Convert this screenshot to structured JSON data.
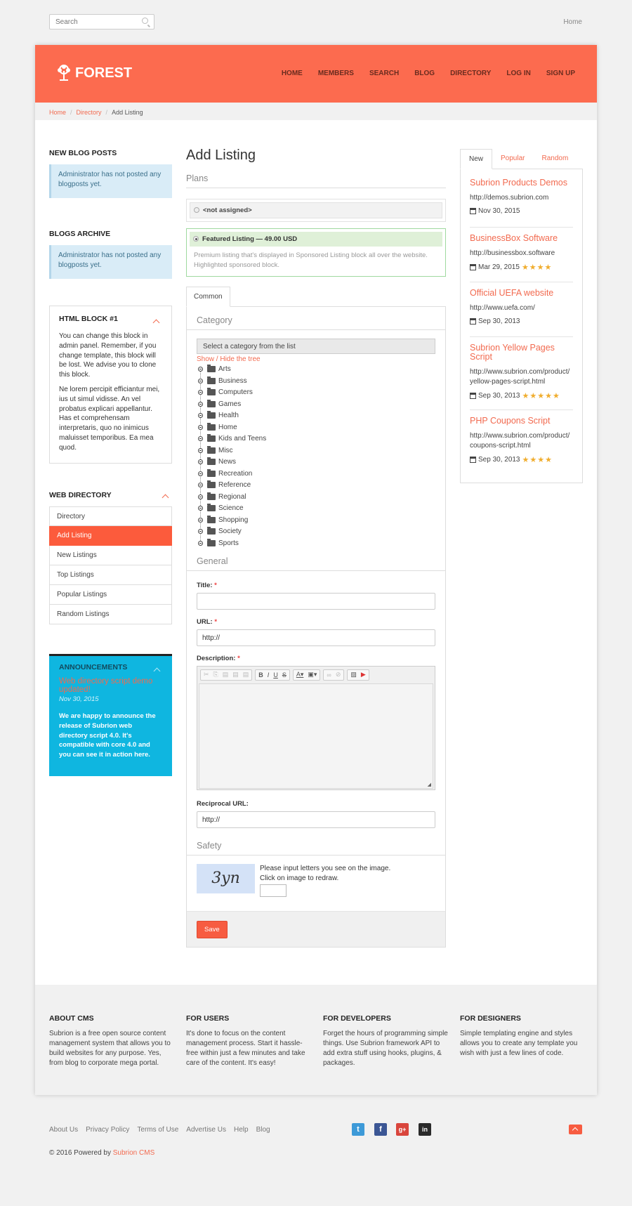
{
  "topbar": {
    "search_placeholder": "Search",
    "home_link": "Home"
  },
  "header": {
    "logo": "FOREST",
    "nav": [
      "HOME",
      "MEMBERS",
      "SEARCH",
      "BLOG",
      "DIRECTORY",
      "LOG IN",
      "SIGN UP"
    ]
  },
  "breadcrumb": {
    "home": "Home",
    "directory": "Directory",
    "current": "Add Listing"
  },
  "left": {
    "blog_posts": {
      "title": "NEW BLOG POSTS",
      "text": "Administrator has not posted any blogposts yet."
    },
    "blogs_archive": {
      "title": "BLOGS ARCHIVE",
      "text": "Administrator has not posted any blogposts yet."
    },
    "html_block": {
      "title": "HTML BLOCK #1",
      "p1": "You can change this block in admin panel. Remember, if you change template, this block will be lost. We advise you to clone this block.",
      "p2": "Ne lorem percipit efficiantur mei, ius ut simul vidisse. An vel probatus explicari appellantur. Has et comprehensam interpretaris, quo no inimicus maluisset temporibus. Ea mea quod."
    },
    "web_directory": {
      "title": "WEB DIRECTORY",
      "items": [
        "Directory",
        "Add Listing",
        "New Listings",
        "Top Listings",
        "Popular Listings",
        "Random Listings"
      ]
    },
    "announcements": {
      "title": "ANNOUNCEMENTS",
      "headline": "Web directory script demo updated!",
      "date": "Nov 30, 2015",
      "body": "We are happy to announce the release of Subrion web directory script 4.0. It's compatible with core 4.0 and you can see it in action here."
    }
  },
  "main": {
    "title": "Add Listing",
    "plans_title": "Plans",
    "plan_none": "<not assigned>",
    "plan_featured": "Featured Listing — 49.00 USD",
    "plan_desc": "Premium listing that's displayed in Sponsored Listing block all over the website. Highlighted sponsored block.",
    "tab": "Common",
    "category_title": "Category",
    "category_select": "Select a category from the list",
    "tree_toggle": "Show / Hide the tree",
    "categories": [
      "Arts",
      "Business",
      "Computers",
      "Games",
      "Health",
      "Home",
      "Kids and Teens",
      "Misc",
      "News",
      "Recreation",
      "Reference",
      "Regional",
      "Science",
      "Shopping",
      "Society",
      "Sports"
    ],
    "general_title": "General",
    "title_label": "Title:",
    "url_label": "URL:",
    "url_value": "http://",
    "description_label": "Description:",
    "reciprocal_label": "Reciprocal URL:",
    "reciprocal_value": "http://",
    "safety_title": "Safety",
    "captcha_text1": "Please input letters you see on the image.",
    "captcha_text2": "Click on image to redraw.",
    "captcha_image_text": "3yn",
    "save": "Save",
    "required_mark": "*"
  },
  "right": {
    "tabs": [
      "New",
      "Popular",
      "Random"
    ],
    "listings": [
      {
        "title": "Subrion Products Demos",
        "url": "http://demos.subrion.com",
        "date": "Nov 30, 2015",
        "stars": 0
      },
      {
        "title": "BusinessBox Software",
        "url": "http://businessbox.software",
        "date": "Mar 29, 2015",
        "stars": 4
      },
      {
        "title": "Official UEFA website",
        "url": "http://www.uefa.com/",
        "date": "Sep 30, 2013",
        "stars": 0
      },
      {
        "title": "Subrion Yellow Pages Script",
        "url": "http://www.subrion.com/product/yellow-pages-script.html",
        "date": "Sep 30, 2013",
        "stars": 5
      },
      {
        "title": "PHP Coupons Script",
        "url": "http://www.subrion.com/product/coupons-script.html",
        "date": "Sep 30, 2013",
        "stars": 4
      }
    ]
  },
  "footer": {
    "cols": [
      {
        "title": "ABOUT CMS",
        "text": "Subrion is a free open source content management system that allows you to build websites for any purpose. Yes, from blog to corporate mega portal."
      },
      {
        "title": "FOR USERS",
        "text": "It's done to focus on the content management process. Start it hassle-free within just a few minutes and take care of the content. It's easy!"
      },
      {
        "title": "FOR DEVELOPERS",
        "text": "Forget the hours of programming simple things. Use Subrion framework API to add extra stuff using hooks, plugins, & packages."
      },
      {
        "title": "FOR DESIGNERS",
        "text": "Simple templating engine and styles allows you to create any template you wish with just a few lines of code."
      }
    ],
    "links": [
      "About Us",
      "Privacy Policy",
      "Terms of Use",
      "Advertise Us",
      "Help",
      "Blog"
    ],
    "social": [
      "t",
      "f",
      "g+",
      "in"
    ],
    "copyright": "© 2016 Powered by",
    "powered": "Subrion CMS"
  },
  "colors": {
    "brand": "#fc6b4f",
    "link": "#f26a4f",
    "announce": "#0fb6e0",
    "star": "#f0ad2e"
  }
}
